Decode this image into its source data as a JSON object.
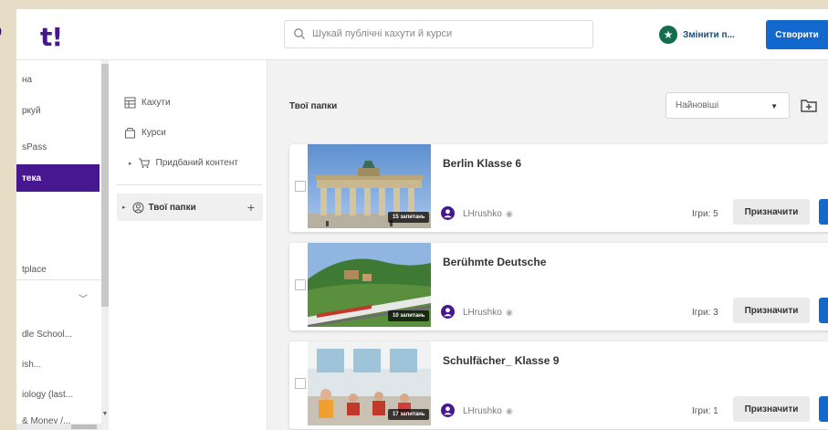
{
  "header": {
    "logo_partial": "t!",
    "logo_cut_letter": "S",
    "search_placeholder": "Шукай публічні кахути й курси",
    "upgrade_label": "Змінити п...",
    "create_label": "Створити"
  },
  "left_nav": {
    "items": [
      {
        "label": "на",
        "active": false
      },
      {
        "label": "ркуй",
        "active": false
      },
      {
        "label": "sPass",
        "active": false
      },
      {
        "label": "тека",
        "active": true
      },
      {
        "label": "tplace",
        "active": false
      },
      {
        "label": "dle School...",
        "active": false
      },
      {
        "label": "ish...",
        "active": false
      },
      {
        "label": "iology (last...",
        "active": false
      },
      {
        "label": "& Money /...",
        "active": false
      }
    ]
  },
  "folder_panel": {
    "kahoots_label": "Кахути",
    "courses_label": "Курси",
    "purchased_label": "Придбаний контент",
    "my_folders_label": "Твої папки",
    "add_symbol": "+"
  },
  "main": {
    "title": "Твої папки",
    "sort_value": "Найновіші",
    "cards": [
      {
        "title": "Berlin Klasse 6",
        "questions": "15 запитань",
        "user": "LHrushko",
        "games": "Ігри: 5",
        "assign_label": "Призначити"
      },
      {
        "title": "Berühmte Deutsche",
        "questions": "10 запитань",
        "user": "LHrushko",
        "games": "Ігри: 3",
        "assign_label": "Призначити"
      },
      {
        "title": "Schulfächer_ Klasse 9",
        "questions": "17 запитань",
        "user": "LHrushko",
        "games": "Ігри: 1",
        "assign_label": "Призначити"
      }
    ]
  },
  "colors": {
    "brand_purple": "#46178f",
    "primary_blue": "#1368ce",
    "upgrade_green": "#136f4b"
  },
  "icons": {
    "search": "search-icon",
    "upgrade": "star-icon",
    "kahoots": "grid-icon",
    "courses": "course-icon",
    "purchased": "cart-icon",
    "my_folders": "user-circle-icon",
    "add_folder": "folder-plus-icon",
    "owner": "avatar-icon"
  }
}
